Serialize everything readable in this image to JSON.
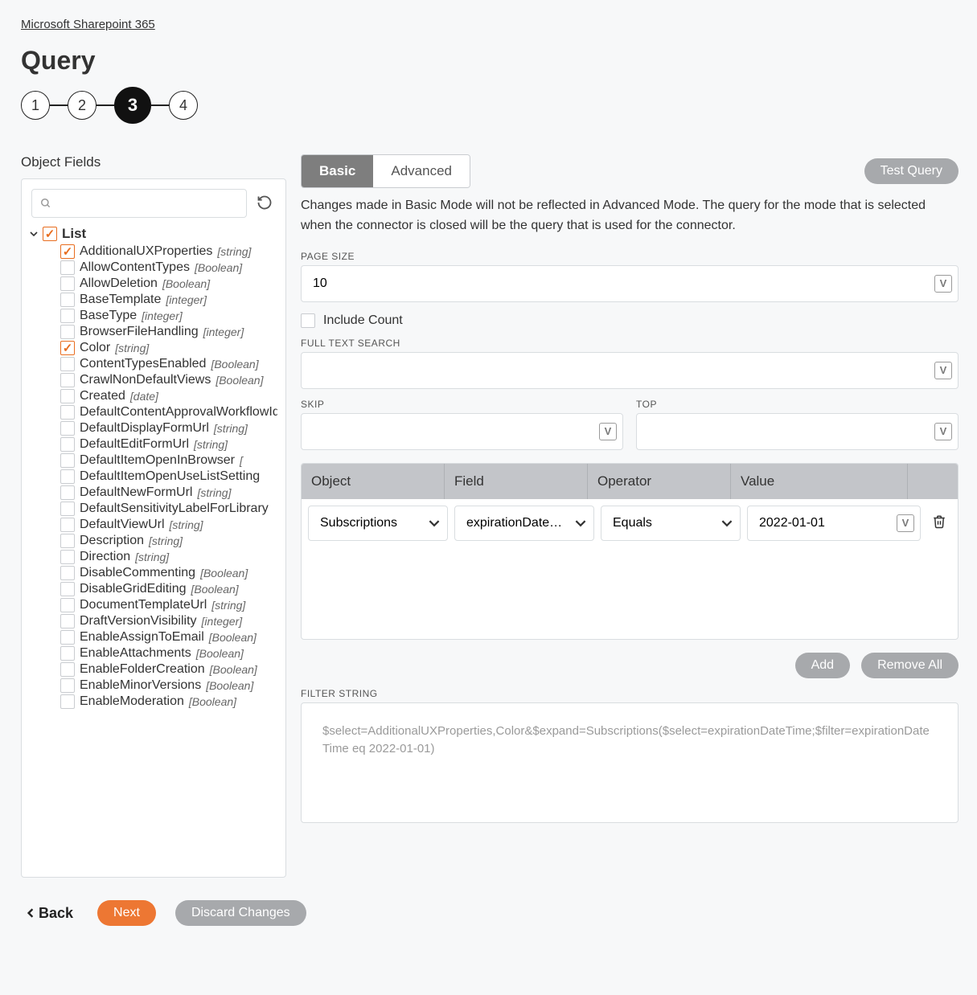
{
  "breadcrumb": "Microsoft Sharepoint 365",
  "title": "Query",
  "steps": [
    "1",
    "2",
    "3",
    "4"
  ],
  "active_step_index": 2,
  "left": {
    "heading": "Object Fields",
    "root_label": "List",
    "root_checked": true,
    "fields": [
      {
        "name": "AdditionalUXProperties",
        "type": "[string]",
        "checked": true
      },
      {
        "name": "AllowContentTypes",
        "type": "[Boolean]",
        "checked": false
      },
      {
        "name": "AllowDeletion",
        "type": "[Boolean]",
        "checked": false
      },
      {
        "name": "BaseTemplate",
        "type": "[integer]",
        "checked": false
      },
      {
        "name": "BaseType",
        "type": "[integer]",
        "checked": false
      },
      {
        "name": "BrowserFileHandling",
        "type": "[integer]",
        "checked": false
      },
      {
        "name": "Color",
        "type": "[string]",
        "checked": true
      },
      {
        "name": "ContentTypesEnabled",
        "type": "[Boolean]",
        "checked": false
      },
      {
        "name": "CrawlNonDefaultViews",
        "type": "[Boolean]",
        "checked": false
      },
      {
        "name": "Created",
        "type": "[date]",
        "checked": false
      },
      {
        "name": "DefaultContentApprovalWorkflowId",
        "type": "",
        "checked": false
      },
      {
        "name": "DefaultDisplayFormUrl",
        "type": "[string]",
        "checked": false
      },
      {
        "name": "DefaultEditFormUrl",
        "type": "[string]",
        "checked": false
      },
      {
        "name": "DefaultItemOpenInBrowser",
        "type": "[",
        "checked": false
      },
      {
        "name": "DefaultItemOpenUseListSetting",
        "type": "",
        "checked": false
      },
      {
        "name": "DefaultNewFormUrl",
        "type": "[string]",
        "checked": false
      },
      {
        "name": "DefaultSensitivityLabelForLibrary",
        "type": "",
        "checked": false
      },
      {
        "name": "DefaultViewUrl",
        "type": "[string]",
        "checked": false
      },
      {
        "name": "Description",
        "type": "[string]",
        "checked": false
      },
      {
        "name": "Direction",
        "type": "[string]",
        "checked": false
      },
      {
        "name": "DisableCommenting",
        "type": "[Boolean]",
        "checked": false
      },
      {
        "name": "DisableGridEditing",
        "type": "[Boolean]",
        "checked": false
      },
      {
        "name": "DocumentTemplateUrl",
        "type": "[string]",
        "checked": false
      },
      {
        "name": "DraftVersionVisibility",
        "type": "[integer]",
        "checked": false
      },
      {
        "name": "EnableAssignToEmail",
        "type": "[Boolean]",
        "checked": false
      },
      {
        "name": "EnableAttachments",
        "type": "[Boolean]",
        "checked": false
      },
      {
        "name": "EnableFolderCreation",
        "type": "[Boolean]",
        "checked": false
      },
      {
        "name": "EnableMinorVersions",
        "type": "[Boolean]",
        "checked": false
      },
      {
        "name": "EnableModeration",
        "type": "[Boolean]",
        "checked": false
      }
    ]
  },
  "right": {
    "tabs": {
      "basic": "Basic",
      "advanced": "Advanced"
    },
    "test_query": "Test Query",
    "helper": "Changes made in Basic Mode will not be reflected in Advanced Mode. The query for the mode that is selected when the connector is closed will be the query that is used for the connector.",
    "page_size_label": "PAGE SIZE",
    "page_size_value": "10",
    "include_count": "Include Count",
    "full_text_label": "FULL TEXT SEARCH",
    "full_text_value": "",
    "skip_label": "SKIP",
    "skip_value": "",
    "top_label": "TOP",
    "top_value": "",
    "table": {
      "headers": {
        "object": "Object",
        "field": "Field",
        "operator": "Operator",
        "value": "Value"
      },
      "row": {
        "object": "Subscriptions",
        "field": "expirationDateTi...",
        "operator": "Equals",
        "value": "2022-01-01"
      }
    },
    "add": "Add",
    "remove_all": "Remove All",
    "filter_label": "FILTER STRING",
    "filter_value": "$select=AdditionalUXProperties,Color&$expand=Subscriptions($select=expirationDateTime;$filter=expirationDateTime eq 2022-01-01)"
  },
  "footer": {
    "back": "Back",
    "next": "Next",
    "discard": "Discard Changes"
  }
}
